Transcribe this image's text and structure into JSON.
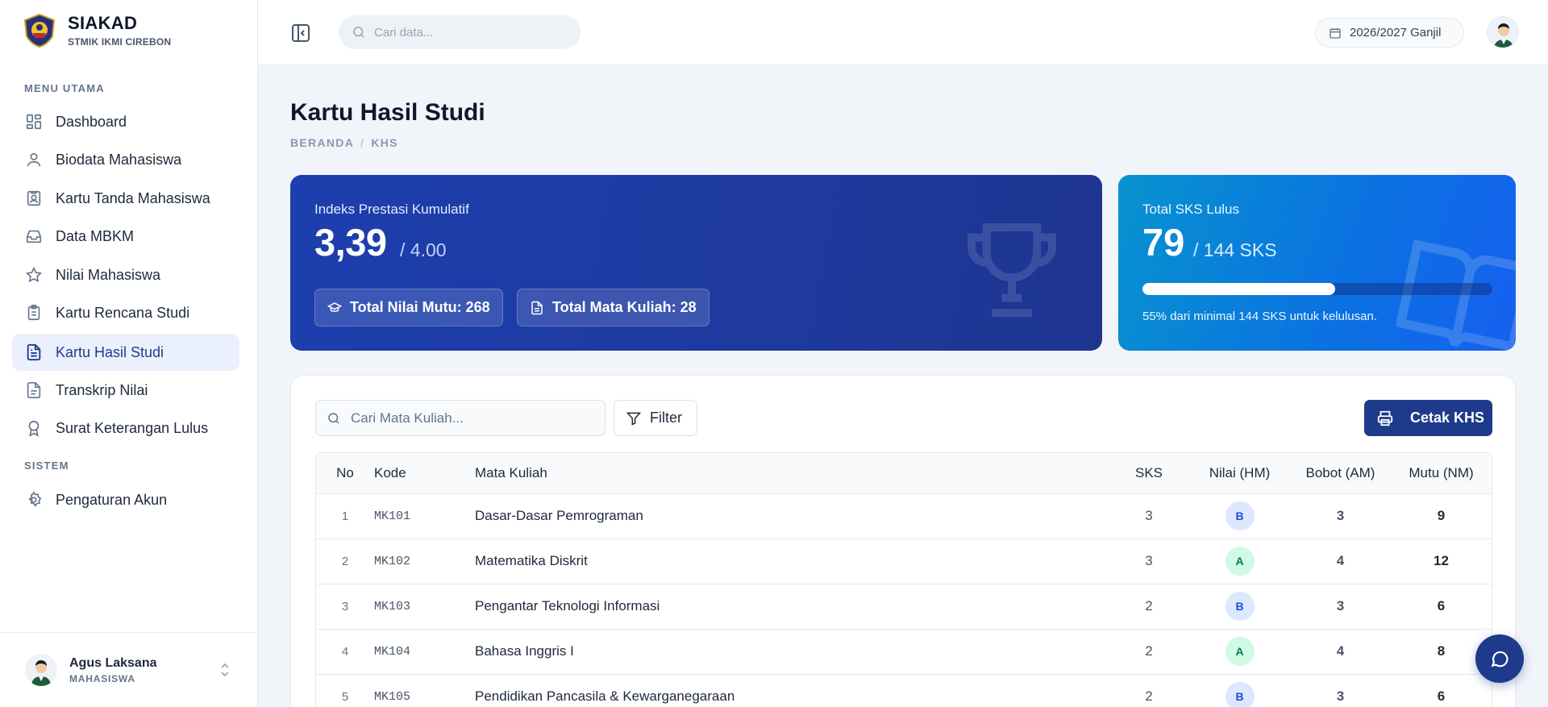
{
  "brand": {
    "title": "SIAKAD",
    "subtitle": "STMIK IKMI CIREBON"
  },
  "sidebar": {
    "section_main": "MENU UTAMA",
    "section_system": "SISTEM",
    "items": [
      {
        "label": "Dashboard",
        "icon": "dashboard-icon"
      },
      {
        "label": "Biodata Mahasiswa",
        "icon": "user-icon"
      },
      {
        "label": "Kartu Tanda Mahasiswa",
        "icon": "id-card-icon"
      },
      {
        "label": "Data MBKM",
        "icon": "inbox-icon"
      },
      {
        "label": "Nilai Mahasiswa",
        "icon": "star-icon"
      },
      {
        "label": "Kartu Rencana Studi",
        "icon": "clipboard-icon"
      },
      {
        "label": "Kartu Hasil Studi",
        "icon": "file-text-icon",
        "active": true
      },
      {
        "label": "Transkrip Nilai",
        "icon": "file-icon"
      },
      {
        "label": "Surat Keterangan Lulus",
        "icon": "award-icon"
      }
    ],
    "system_items": [
      {
        "label": "Pengaturan Akun",
        "icon": "gear-icon"
      }
    ],
    "user": {
      "name": "Agus Laksana",
      "role": "MAHASISWA"
    }
  },
  "topbar": {
    "search_placeholder": "Cari data...",
    "academic_year": "2026/2027 Ganjil"
  },
  "page": {
    "title": "Kartu Hasil Studi",
    "breadcrumb": [
      "BERANDA",
      "KHS"
    ]
  },
  "ipk_card": {
    "label": "Indeks Prestasi Kumulatif",
    "value": "3,39",
    "scale": "/ 4.00",
    "chip_mutu": "Total Nilai Mutu: 268",
    "chip_mk": "Total Mata Kuliah: 28"
  },
  "sks_card": {
    "label": "Total SKS Lulus",
    "value": "79",
    "scale": "/ 144 SKS",
    "progress_percent": 55,
    "note": "55% dari minimal 144 SKS untuk kelulusan."
  },
  "panel": {
    "search_placeholder": "Cari Mata Kuliah...",
    "filter_label": "Filter",
    "print_label": "Cetak KHS",
    "columns": [
      "No",
      "Kode",
      "Mata Kuliah",
      "SKS",
      "Nilai (HM)",
      "Bobot (AM)",
      "Mutu (NM)"
    ],
    "rows": [
      {
        "no": "1",
        "kode": "MK101",
        "mk": "Dasar-Dasar Pemrograman",
        "sks": "3",
        "nilai": "B",
        "bobot": "3",
        "mutu": "9"
      },
      {
        "no": "2",
        "kode": "MK102",
        "mk": "Matematika Diskrit",
        "sks": "3",
        "nilai": "A",
        "bobot": "4",
        "mutu": "12"
      },
      {
        "no": "3",
        "kode": "MK103",
        "mk": "Pengantar Teknologi Informasi",
        "sks": "2",
        "nilai": "B",
        "bobot": "3",
        "mutu": "6"
      },
      {
        "no": "4",
        "kode": "MK104",
        "mk": "Bahasa Inggris I",
        "sks": "2",
        "nilai": "A",
        "bobot": "4",
        "mutu": "8"
      },
      {
        "no": "5",
        "kode": "MK105",
        "mk": "Pendidikan Pancasila & Kewarganegaraan",
        "sks": "2",
        "nilai": "B",
        "bobot": "3",
        "mutu": "6"
      }
    ]
  },
  "colors": {
    "primary": "#1e3a8a",
    "grade_a": "#047857",
    "grade_b": "#1d4ed8"
  }
}
